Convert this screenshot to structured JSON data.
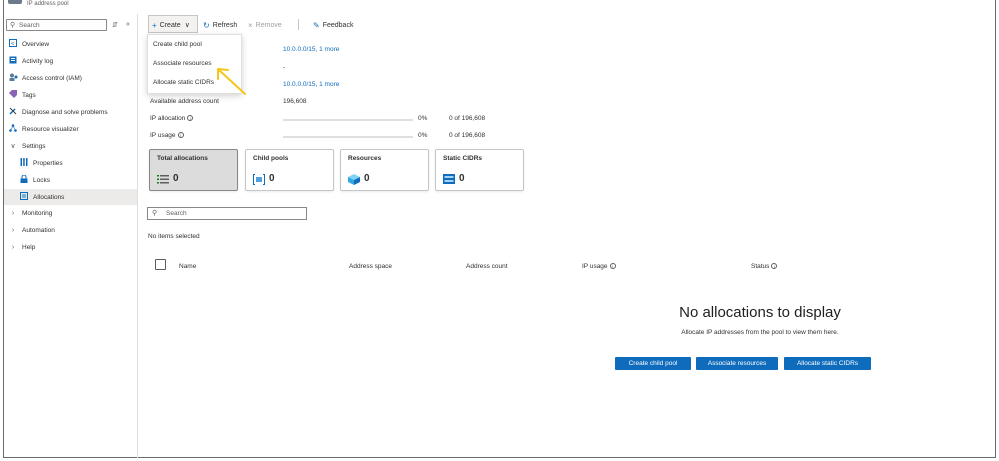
{
  "header": {
    "subtitle": "IP address pool"
  },
  "sidebar": {
    "search_placeholder": "Search",
    "items": [
      {
        "label": "Overview",
        "icon": "overview-icon"
      },
      {
        "label": "Activity log",
        "icon": "activity-log-icon"
      },
      {
        "label": "Access control (IAM)",
        "icon": "iam-icon"
      },
      {
        "label": "Tags",
        "icon": "tag-icon"
      },
      {
        "label": "Diagnose and solve problems",
        "icon": "wrench-icon"
      },
      {
        "label": "Resource visualizer",
        "icon": "visualizer-icon"
      },
      {
        "label": "Settings",
        "icon": "chevron-down-icon"
      },
      {
        "label": "Properties",
        "icon": "properties-icon"
      },
      {
        "label": "Locks",
        "icon": "lock-icon"
      },
      {
        "label": "Allocations",
        "icon": "allocations-icon"
      },
      {
        "label": "Monitoring",
        "icon": "chevron-right-icon"
      },
      {
        "label": "Automation",
        "icon": "chevron-right-icon"
      },
      {
        "label": "Help",
        "icon": "chevron-right-icon"
      }
    ]
  },
  "toolbar": {
    "create": "Create",
    "refresh": "Refresh",
    "remove": "Remove",
    "feedback": "Feedback"
  },
  "create_menu": {
    "items": [
      "Create child pool",
      "Associate resources",
      "Allocate static CIDRs"
    ]
  },
  "essentials": {
    "address_value_1": "10.0.0.0/15, 1 more",
    "dash_value": "-",
    "address_value_2": "10.0.0.0/15, 1 more",
    "available_label": "Available address count",
    "available_value": "196,608",
    "ip_allocation_label": "IP allocation",
    "ip_allocation_pct": "0%",
    "ip_allocation_of": "0 of 196,608",
    "ip_allocation_fraction": 0,
    "ip_usage_label": "IP usage",
    "ip_usage_pct": "0%",
    "ip_usage_of": "0 of 196,608",
    "ip_usage_fraction": 0
  },
  "cards": [
    {
      "title": "Total allocations",
      "value": "0",
      "icon": "list-icon",
      "selected": true
    },
    {
      "title": "Child pools",
      "value": "0",
      "icon": "child-pool-icon",
      "selected": false
    },
    {
      "title": "Resources",
      "value": "0",
      "icon": "cube-icon",
      "selected": false
    },
    {
      "title": "Static CIDRs",
      "value": "0",
      "icon": "cidr-icon",
      "selected": false
    }
  ],
  "grid": {
    "search_placeholder": "Search",
    "selection_text": "No items selected",
    "columns": [
      "Name",
      "Address space",
      "Address count",
      "IP usage",
      "Status"
    ]
  },
  "empty_state": {
    "title": "No allocations to display",
    "subtitle": "Allocate IP addresses from the pool to view them here.",
    "buttons": [
      "Create child pool",
      "Associate resources",
      "Allocate static CIDRs"
    ]
  },
  "colors": {
    "accent": "#0f6cbd",
    "annotation_arrow": "#f5c518"
  }
}
